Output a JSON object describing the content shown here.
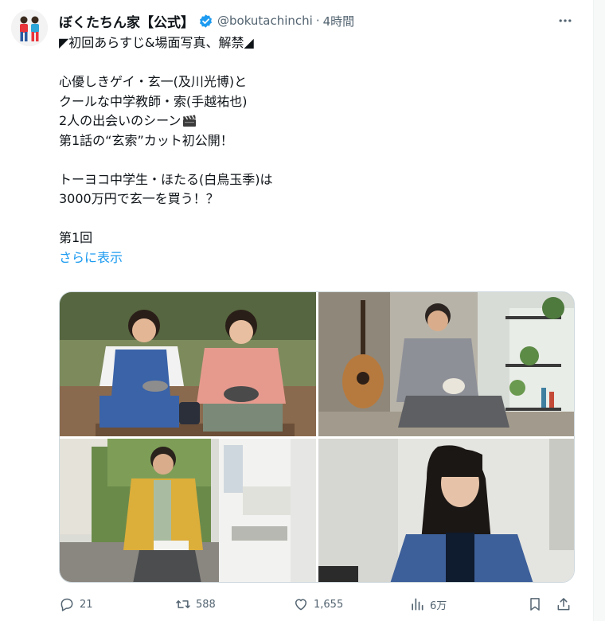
{
  "account": {
    "display_name": "ぼくたちん家【公式】",
    "handle": "@bokutachinchi",
    "separator": "·",
    "time": "4時間",
    "verified": true
  },
  "tweet": {
    "lines": [
      "◤初回あらすじ&場面写真、解禁◢",
      "",
      "心優しきゲイ・玄一(及川光博)と",
      "クールな中学教師・索(手越祐也)",
      "2人の出会いのシーン",
      "第1話の“玄索”カット初公開！",
      "",
      "トーヨコ中学生・ほたる(白鳥玉季)は",
      "3000万円で玄一を買う！？",
      "",
      "第1回"
    ],
    "show_more": "さらに表示"
  },
  "icons": {
    "avatar": "two-people-avatar-icon",
    "verified": "verified-badge-icon",
    "more": "more-options-icon",
    "clapper": "clapper-board-emoji-icon",
    "reply": "reply-icon",
    "retweet": "retweet-icon",
    "like": "heart-icon",
    "views": "views-chart-icon",
    "bookmark": "bookmark-icon",
    "share": "share-icon"
  },
  "media": {
    "count": 4
  },
  "metrics": {
    "replies": "21",
    "retweets": "588",
    "likes": "1,655",
    "views": "6万"
  },
  "colors": {
    "accent": "#1d9bf0",
    "text": "#0f1419",
    "secondary_text": "#536471"
  }
}
